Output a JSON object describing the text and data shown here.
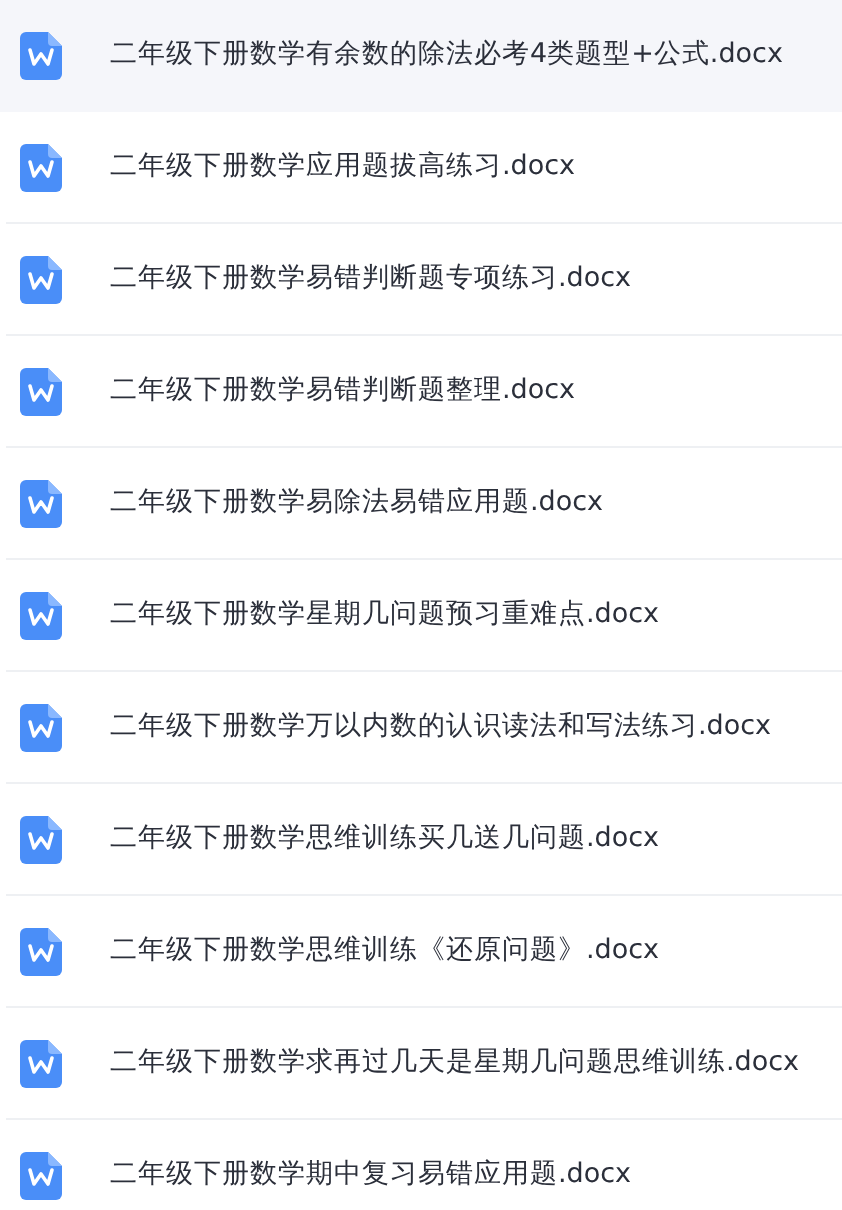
{
  "files": [
    {
      "name": "二年级下册数学有余数的除法必考4类题型+公式.docx",
      "selected": true
    },
    {
      "name": "二年级下册数学应用题拔高练习.docx",
      "selected": false
    },
    {
      "name": "二年级下册数学易错判断题专项练习.docx",
      "selected": false
    },
    {
      "name": "二年级下册数学易错判断题整理.docx",
      "selected": false
    },
    {
      "name": "二年级下册数学易除法易错应用题.docx",
      "selected": false
    },
    {
      "name": "二年级下册数学星期几问题预习重难点.docx",
      "selected": false
    },
    {
      "name": "二年级下册数学万以内数的认识读法和写法练习.docx",
      "selected": false
    },
    {
      "name": "二年级下册数学思维训练买几送几问题.docx",
      "selected": false
    },
    {
      "name": "二年级下册数学思维训练《还原问题》.docx",
      "selected": false
    },
    {
      "name": "二年级下册数学求再过几天是星期几问题思维训练.docx",
      "selected": false
    },
    {
      "name": "二年级下册数学期中复习易错应用题.docx",
      "selected": false
    }
  ]
}
